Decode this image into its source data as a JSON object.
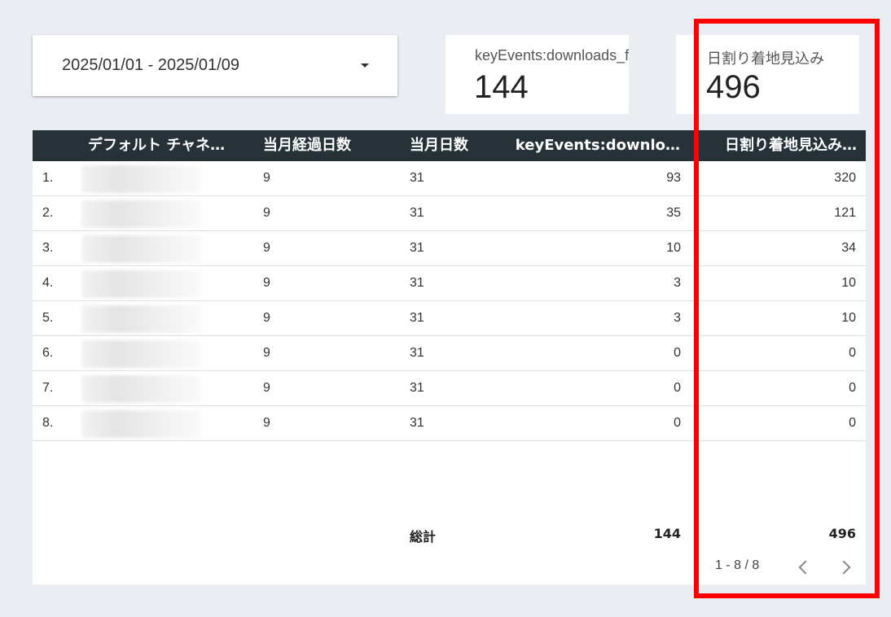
{
  "date_range": {
    "label": "2025/01/01 - 2025/01/09"
  },
  "scorecards": [
    {
      "label": "keyEvents:downloads_fi",
      "value": "144"
    },
    {
      "label": "日割り着地見込み",
      "value": "496"
    }
  ],
  "table": {
    "headers": [
      "デフォルト チャネ…",
      "当月経過日数",
      "当月日数",
      "keyEvents:downlo…",
      "日割り着地見込み…"
    ],
    "rows": [
      {
        "idx": "1.",
        "c2": "9",
        "c3": "31",
        "c4": "93",
        "c5": "320"
      },
      {
        "idx": "2.",
        "c2": "9",
        "c3": "31",
        "c4": "35",
        "c5": "121"
      },
      {
        "idx": "3.",
        "c2": "9",
        "c3": "31",
        "c4": "10",
        "c5": "34"
      },
      {
        "idx": "4.",
        "c2": "9",
        "c3": "31",
        "c4": "3",
        "c5": "10"
      },
      {
        "idx": "5.",
        "c2": "9",
        "c3": "31",
        "c4": "3",
        "c5": "10"
      },
      {
        "idx": "6.",
        "c2": "9",
        "c3": "31",
        "c4": "0",
        "c5": "0"
      },
      {
        "idx": "7.",
        "c2": "9",
        "c3": "31",
        "c4": "0",
        "c5": "0"
      },
      {
        "idx": "8.",
        "c2": "9",
        "c3": "31",
        "c4": "0",
        "c5": "0"
      }
    ],
    "total": {
      "label": "総計",
      "c4": "144",
      "c5": "496"
    }
  },
  "pagination": {
    "text": "1 - 8 / 8"
  },
  "colors": {
    "header_bg": "#263238",
    "highlight": "#ff0000",
    "page_bg": "#eaeef2"
  }
}
